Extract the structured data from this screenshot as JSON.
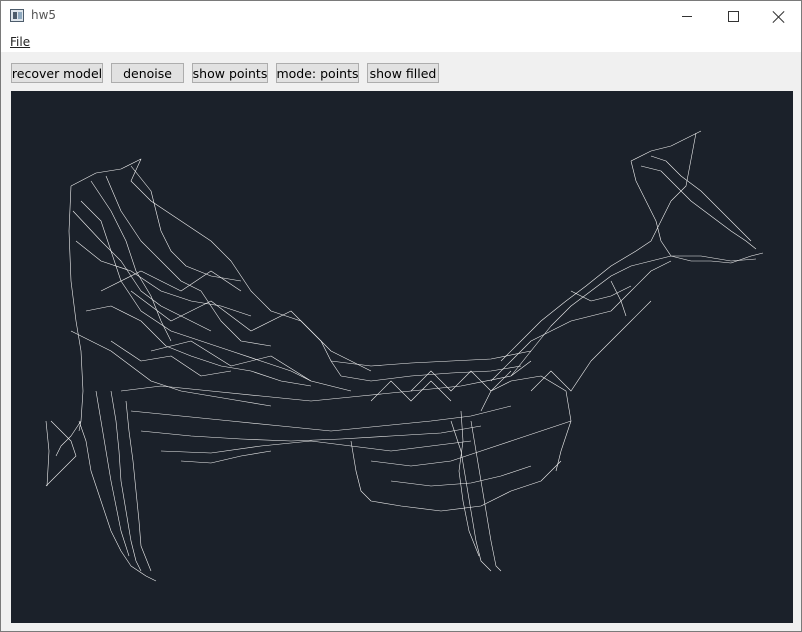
{
  "window": {
    "title": "hw5",
    "accent": "#1b212a"
  },
  "menu": {
    "items": [
      {
        "label": "File"
      }
    ]
  },
  "toolbar": {
    "buttons": [
      {
        "label": "recover model"
      },
      {
        "label": "denoise"
      },
      {
        "label": "show points"
      },
      {
        "label": "mode: points"
      },
      {
        "label": "show filled"
      }
    ]
  },
  "viewport": {
    "background": "#1b212a",
    "mesh_color": "#ffffff"
  }
}
